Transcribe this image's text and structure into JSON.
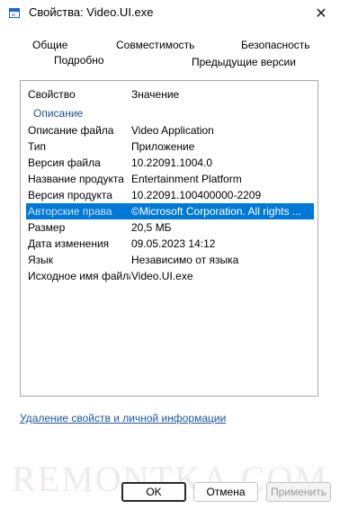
{
  "window": {
    "title": "Свойства: Video.UI.exe",
    "close_glyph": "✕"
  },
  "tabs": {
    "general": "Общие",
    "compatibility": "Совместимость",
    "security": "Безопасность",
    "details": "Подробно",
    "previous_versions": "Предыдущие версии"
  },
  "details": {
    "header": {
      "property": "Свойство",
      "value": "Значение"
    },
    "section_title": "Описание",
    "rows": [
      {
        "property": "Описание файла",
        "value": "Video Application"
      },
      {
        "property": "Тип",
        "value": "Приложение"
      },
      {
        "property": "Версия файла",
        "value": "10.22091.1004.0"
      },
      {
        "property": "Название продукта",
        "value": "Entertainment Platform"
      },
      {
        "property": "Версия продукта",
        "value": "10.22091.100400000-2209"
      },
      {
        "property": "Авторские права",
        "value": "©Microsoft Corporation.  All rights ..."
      },
      {
        "property": "Размер",
        "value": "20,5 МБ"
      },
      {
        "property": "Дата изменения",
        "value": "09.05.2023 14:12"
      },
      {
        "property": "Язык",
        "value": "Независимо от языка"
      },
      {
        "property": "Исходное имя файла",
        "value": "Video.UI.exe"
      }
    ]
  },
  "link": "Удаление свойств и личной информации",
  "watermark": "REMONTKA.COM",
  "buttons": {
    "ok": "OK",
    "cancel": "Отмена",
    "apply": "Применить"
  },
  "colors": {
    "selection": "#0078d7",
    "link": "#1a55a8",
    "section": "#1e4f91"
  }
}
